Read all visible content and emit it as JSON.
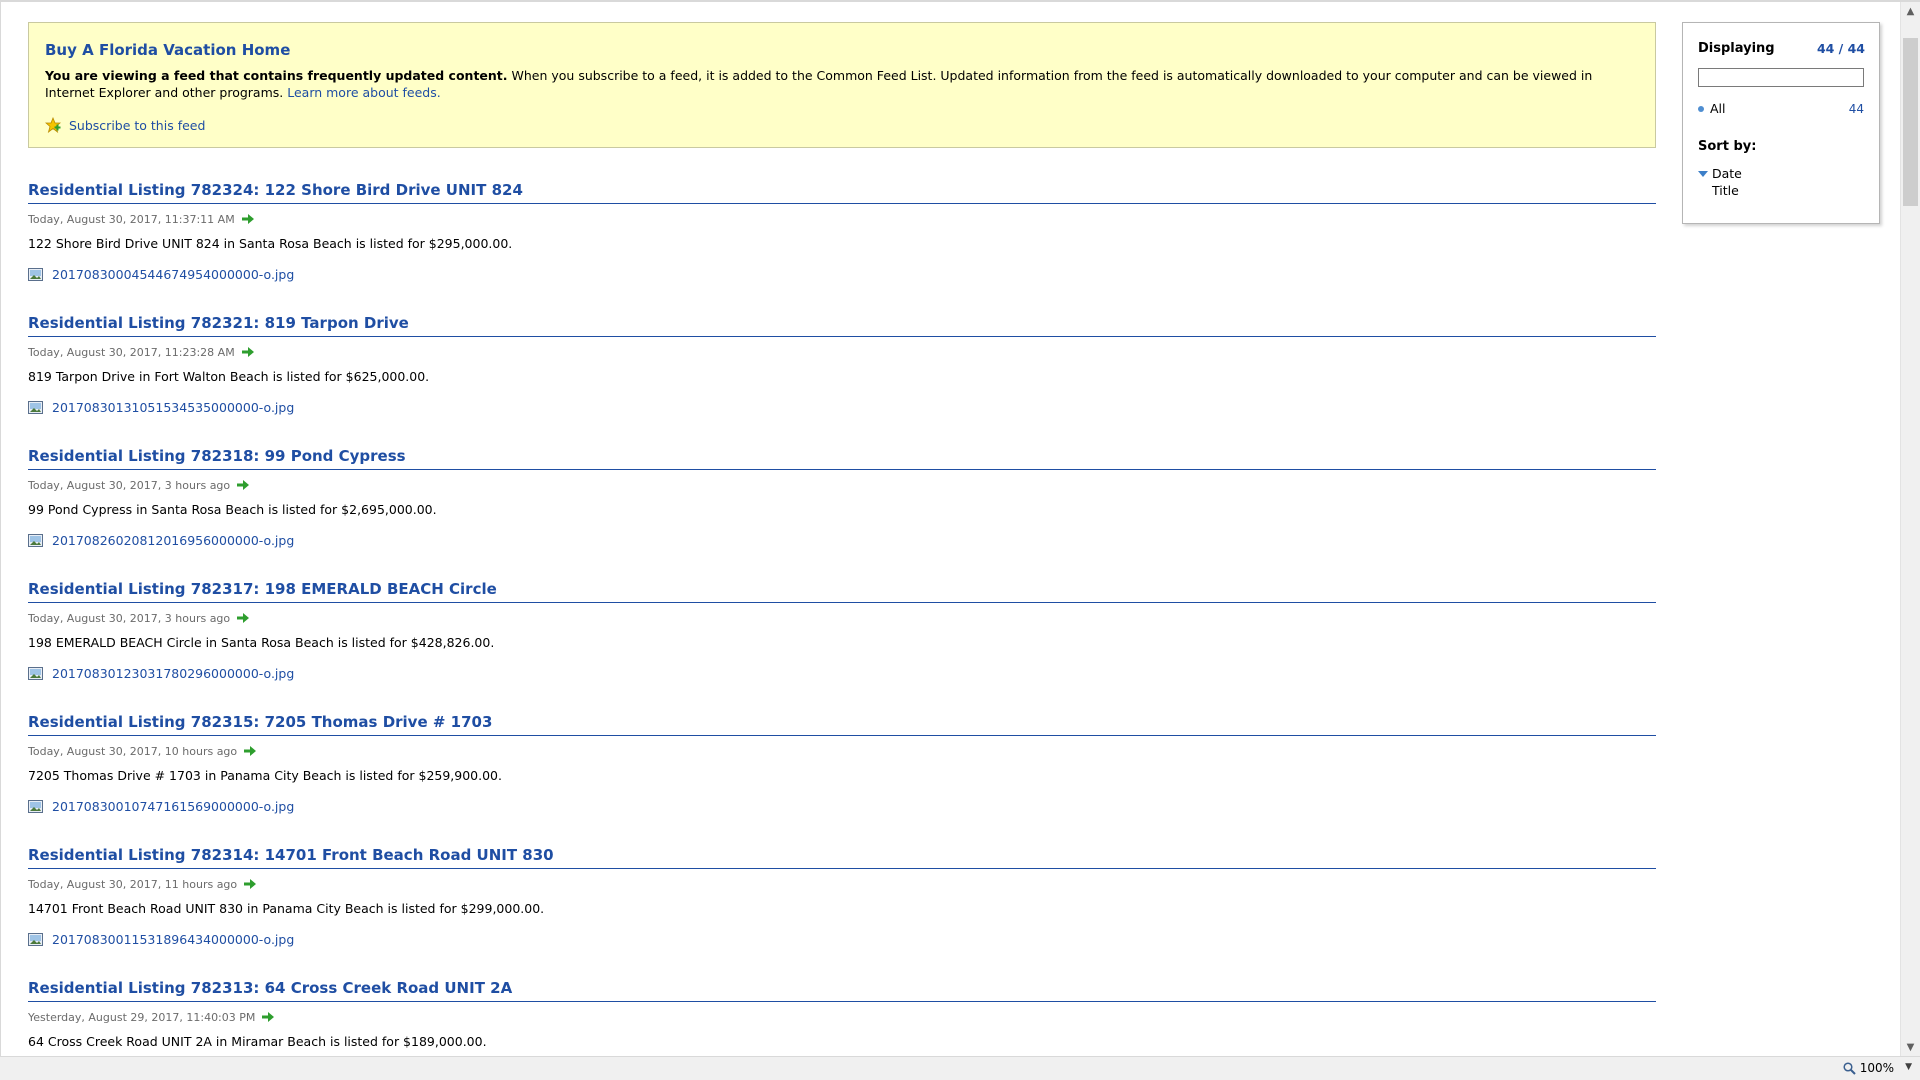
{
  "header": {
    "title": "Buy A Florida Vacation Home",
    "desc_bold": "You are viewing a feed that contains frequently updated content.",
    "desc_rest": " When you subscribe to a feed, it is added to the Common Feed List. Updated information from the feed is automatically downloaded to your computer and can be viewed in Internet Explorer and other programs. ",
    "learn_more": "Learn more about feeds.",
    "subscribe": "Subscribe to this feed"
  },
  "listings": [
    {
      "title": "Residential Listing 782324: 122 Shore Bird Drive UNIT 824",
      "date": "Today, August 30, 2017, 11:37:11 AM",
      "desc": "122 Shore Bird Drive UNIT 824 in Santa Rosa Beach is listed for $295,000.00.",
      "file": "20170830004544674954000000-o.jpg"
    },
    {
      "title": "Residential Listing 782321: 819 Tarpon Drive",
      "date": "Today, August 30, 2017, 11:23:28 AM",
      "desc": "819 Tarpon Drive in Fort Walton Beach is listed for $625,000.00.",
      "file": "20170830131051534535000000-o.jpg"
    },
    {
      "title": "Residential Listing 782318: 99 Pond Cypress",
      "date": "Today, August 30, 2017, 3 hours ago",
      "desc": "99 Pond Cypress in Santa Rosa Beach is listed for $2,695,000.00.",
      "file": "20170826020812016956000000-o.jpg"
    },
    {
      "title": "Residential Listing 782317: 198 EMERALD BEACH Circle",
      "date": "Today, August 30, 2017, 3 hours ago",
      "desc": "198 EMERALD BEACH Circle in Santa Rosa Beach is listed for $428,826.00.",
      "file": "20170830123031780296000000-o.jpg"
    },
    {
      "title": "Residential Listing 782315: 7205 Thomas Drive # 1703",
      "date": "Today, August 30, 2017, 10 hours ago",
      "desc": "7205 Thomas Drive # 1703 in Panama City Beach is listed for $259,900.00.",
      "file": "20170830010747161569000000-o.jpg"
    },
    {
      "title": "Residential Listing 782314: 14701 Front Beach Road UNIT 830",
      "date": "Today, August 30, 2017, 11 hours ago",
      "desc": "14701 Front Beach Road UNIT 830 in Panama City Beach is listed for $299,000.00.",
      "file": "20170830011531896434000000-o.jpg"
    },
    {
      "title": "Residential Listing 782313: 64 Cross Creek Road UNIT 2A",
      "date": "Yesterday, August 29, 2017, 11:40:03 PM",
      "desc": "64 Cross Creek Road UNIT 2A in Miramar Beach is listed for $189,000.00.",
      "file": ""
    }
  ],
  "panel": {
    "displaying_label": "Displaying",
    "displaying_count": "44 / 44",
    "filter_all_label": "All",
    "filter_all_count": "44",
    "sort_label": "Sort by:",
    "sort_date": "Date",
    "sort_title": "Title"
  },
  "status": {
    "zoom": "100%"
  },
  "colors": {
    "link": "#1f4ea3",
    "header_bg": "#ffffc8",
    "arrow": "#2e9e2e"
  }
}
